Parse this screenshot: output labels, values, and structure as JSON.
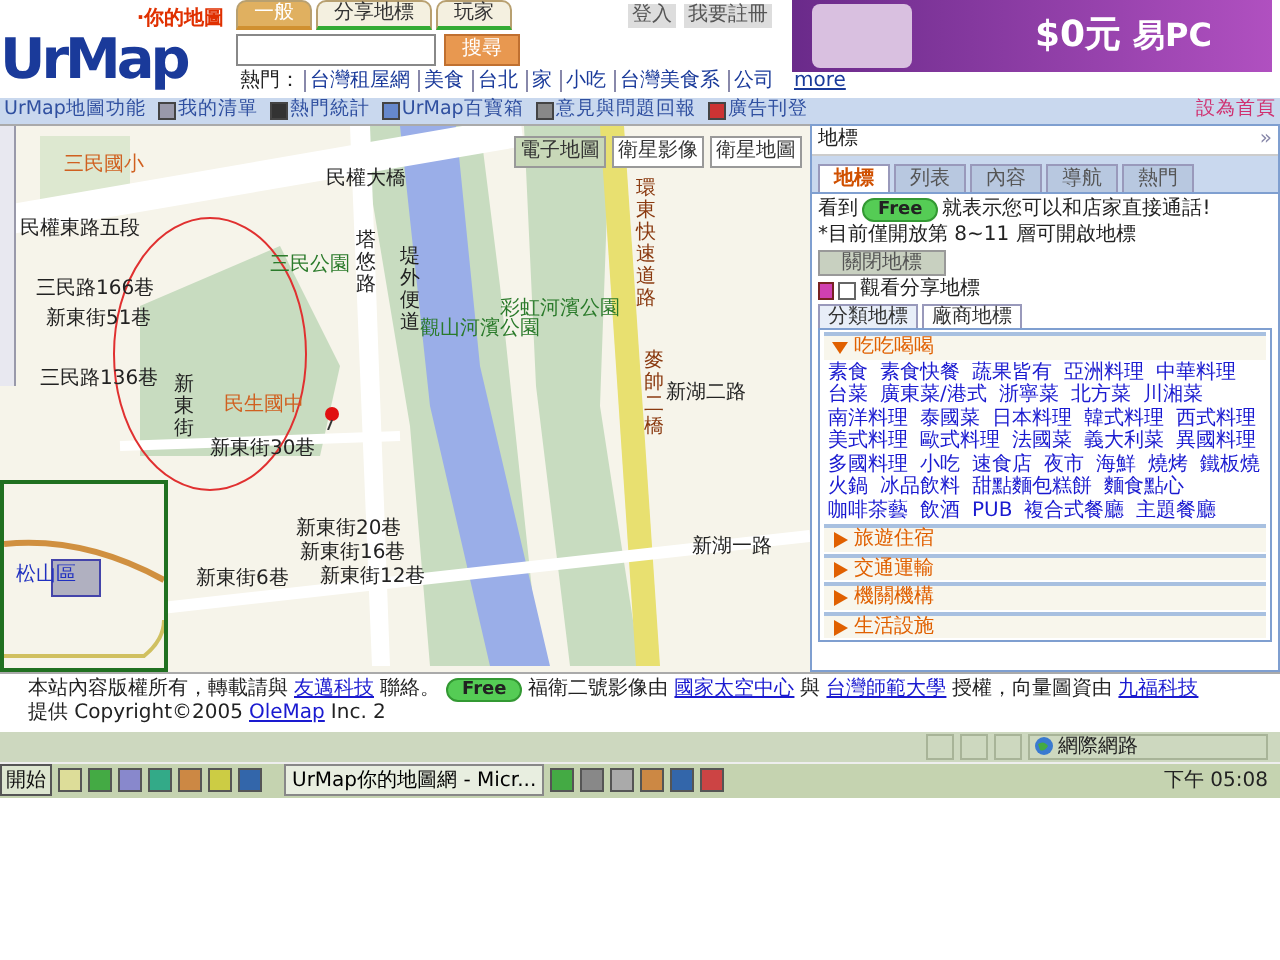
{
  "header": {
    "logo": "UrMap",
    "tagline": "‧你的地圖",
    "search_tabs": [
      {
        "label": "一般",
        "selected": true
      },
      {
        "label": "分享地標",
        "selected": false
      },
      {
        "label": "玩家",
        "selected": false
      }
    ],
    "account_links": [
      "登入",
      "我要註冊"
    ],
    "search": {
      "button": "搜尋"
    },
    "hot": {
      "label": "熱門：",
      "links": [
        "台灣租屋網",
        "美食",
        "台北",
        "家",
        "小吃",
        "台灣美食系",
        "公司"
      ],
      "more": "more"
    },
    "ad": {
      "line_1": "$0元",
      "line_2": "易PC"
    }
  },
  "nav": {
    "items": [
      {
        "label": "UrMap地圖功能"
      },
      {
        "label": "我的清單"
      },
      {
        "label": "熱門統計"
      },
      {
        "label": "UrMap百寶箱"
      },
      {
        "label": "意見與問題回報"
      },
      {
        "label": "廣告刊登"
      }
    ],
    "home": "設為首頁"
  },
  "map": {
    "view_buttons": [
      {
        "label": "電子地圖",
        "selected": true
      },
      {
        "label": "衛星影像",
        "selected": false
      },
      {
        "label": "衛星地圖",
        "selected": false
      }
    ],
    "labels": [
      {
        "text": "三民國小",
        "kind": "school"
      },
      {
        "text": "民權大橋",
        "kind": "road"
      },
      {
        "text": "民權東路五段",
        "kind": "road"
      },
      {
        "text": "三民公園",
        "kind": "park"
      },
      {
        "text": "塔悠路",
        "kind": "road"
      },
      {
        "text": "堤外便道",
        "kind": "road"
      },
      {
        "text": "觀山河濱公園",
        "kind": "park"
      },
      {
        "text": "彩虹河濱公園",
        "kind": "park"
      },
      {
        "text": "三民路166巷",
        "kind": "road"
      },
      {
        "text": "新東街51巷",
        "kind": "road"
      },
      {
        "text": "三民路136巷",
        "kind": "road"
      },
      {
        "text": "民生國中",
        "kind": "school"
      },
      {
        "text": "新東街",
        "kind": "road"
      },
      {
        "text": "新東街30巷",
        "kind": "road"
      },
      {
        "text": "新東街20巷",
        "kind": "road"
      },
      {
        "text": "新東街16巷",
        "kind": "road"
      },
      {
        "text": "新東街6巷",
        "kind": "road"
      },
      {
        "text": "新東街12巷",
        "kind": "road"
      },
      {
        "text": "新湖二路",
        "kind": "road"
      },
      {
        "text": "新湖一路",
        "kind": "road"
      },
      {
        "text": "環東快速道路",
        "kind": "highway"
      },
      {
        "text": "麥帥二橋",
        "kind": "highway"
      }
    ],
    "overview": {
      "label": "松山區"
    }
  },
  "panel": {
    "title": "地標",
    "collapse": "»",
    "tabs": [
      {
        "label": "地標",
        "selected": true
      },
      {
        "label": "列表",
        "selected": false
      },
      {
        "label": "內容",
        "selected": false
      },
      {
        "label": "導航",
        "selected": false
      },
      {
        "label": "熱門",
        "selected": false
      }
    ],
    "notice_before": "看到",
    "free_badge": "Free",
    "notice_after": "就表示您可以和店家直接通話!",
    "layer_note": "*目前僅開放第 8~11 層可開啟地標",
    "close_button": "關閉地標",
    "share": {
      "label": "觀看分享地標",
      "checked": false
    },
    "sub_tabs": [
      {
        "label": "分類地標",
        "selected": true
      },
      {
        "label": "廠商地標",
        "selected": false
      }
    ],
    "categories": [
      {
        "name": "吃吃喝喝",
        "expanded": true,
        "items": [
          "素食",
          "素食快餐",
          "蔬果皆有",
          "亞洲料理",
          "中華料理",
          "台菜",
          "廣東菜/港式",
          "浙寧菜",
          "北方菜",
          "川湘菜",
          "南洋料理",
          "泰國菜",
          "日本料理",
          "韓式料理",
          "西式料理",
          "美式料理",
          "歐式料理",
          "法國菜",
          "義大利菜",
          "異國料理",
          "多國料理",
          "小吃",
          "速食店",
          "夜市",
          "海鮮",
          "燒烤",
          "鐵板燒",
          "火鍋",
          "冰品飲料",
          "甜點麵包糕餅",
          "麵食點心",
          "咖啡茶藝",
          "飲酒",
          "PUB",
          "複合式餐廳",
          "主題餐廳"
        ]
      },
      {
        "name": "旅遊住宿",
        "expanded": false
      },
      {
        "name": "交通運輸",
        "expanded": false
      },
      {
        "name": "機關機構",
        "expanded": false
      },
      {
        "name": "生活設施",
        "expanded": false
      }
    ]
  },
  "footer": {
    "segments": [
      {
        "kind": "text",
        "text": "本站內容版權所有，轉載請與"
      },
      {
        "kind": "link",
        "text": "友邁科技"
      },
      {
        "kind": "text",
        "text": "聯絡。"
      },
      {
        "kind": "badge",
        "text": "Free"
      },
      {
        "kind": "text",
        "text": "福衛二號影像由"
      },
      {
        "kind": "link",
        "text": "國家太空中心"
      },
      {
        "kind": "text",
        "text": "與"
      },
      {
        "kind": "link",
        "text": "台灣師範大學"
      },
      {
        "kind": "text",
        "text": "授權，向量圖資由"
      },
      {
        "kind": "link",
        "text": "九福科技"
      },
      {
        "kind": "text",
        "text": "提供 Copyright©2005"
      },
      {
        "kind": "link",
        "text": "OleMap"
      },
      {
        "kind": "text",
        "text": "Inc. 2"
      }
    ]
  },
  "status_bar": {
    "zone": "網際網路"
  },
  "taskbar": {
    "start": "開始",
    "task": "UrMap你的地圖網 - Micr...",
    "clock": "下午 05:08"
  }
}
